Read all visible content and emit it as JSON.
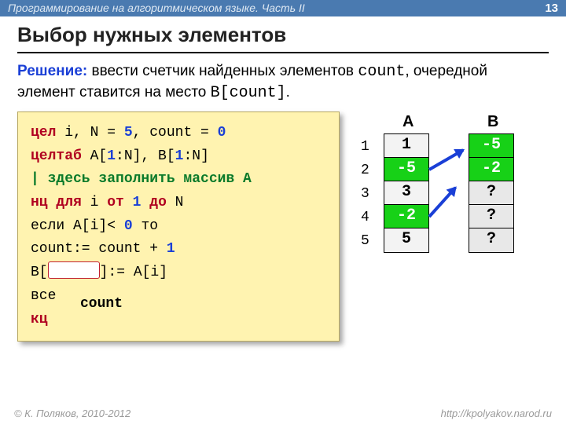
{
  "topbar": {
    "course": "Программирование на алгоритмическом языке. Часть II",
    "page": "13"
  },
  "title": "Выбор нужных элементов",
  "desc": {
    "kw": "Решение:",
    "t1": " ввести счетчик найденных элементов ",
    "m1": "count",
    "t2": ", очередной элемент ставится на место ",
    "m2": "B[count]",
    "t3": "."
  },
  "code": {
    "l1a": "цел",
    "l1b": " i, N = ",
    "l1c": "5",
    "l1d": ", count = ",
    "l1e": "0",
    "l2a": "целтаб",
    "l2b": " A[",
    "l2c": "1",
    "l2d": ":N], B[",
    "l2e": "1",
    "l2f": ":N]",
    "l3": " | здесь заполнить массив A",
    "l4a": "нц для",
    "l4b": " i ",
    "l4c": "от",
    "l4d": " ",
    "l4e": "1",
    "l4f": " ",
    "l4g": "до",
    "l4h": " N",
    "l5a": "  если A[i]< ",
    "l5b": "0",
    "l5c": " то",
    "l6a": "    count:= count + ",
    "l6b": "1",
    "l7a": "    B[",
    "l7b": "]:= A[i]",
    "l8": "  все",
    "l9": "кц",
    "overlay": "count"
  },
  "arrays": {
    "labelA": "A",
    "labelB": "B",
    "idx": [
      "1",
      "2",
      "3",
      "4",
      "5"
    ],
    "A": [
      {
        "v": "1",
        "neg": false
      },
      {
        "v": "-5",
        "neg": true
      },
      {
        "v": "3",
        "neg": false
      },
      {
        "v": "-2",
        "neg": true
      },
      {
        "v": "5",
        "neg": false
      }
    ],
    "B": [
      {
        "v": "-5",
        "neg": true
      },
      {
        "v": "-2",
        "neg": true
      },
      {
        "v": "?",
        "q": true
      },
      {
        "v": "?",
        "q": true
      },
      {
        "v": "?",
        "q": true
      }
    ]
  },
  "footer": {
    "left": "© К. Поляков, 2010-2012",
    "right": "http://kpolyakov.narod.ru"
  }
}
